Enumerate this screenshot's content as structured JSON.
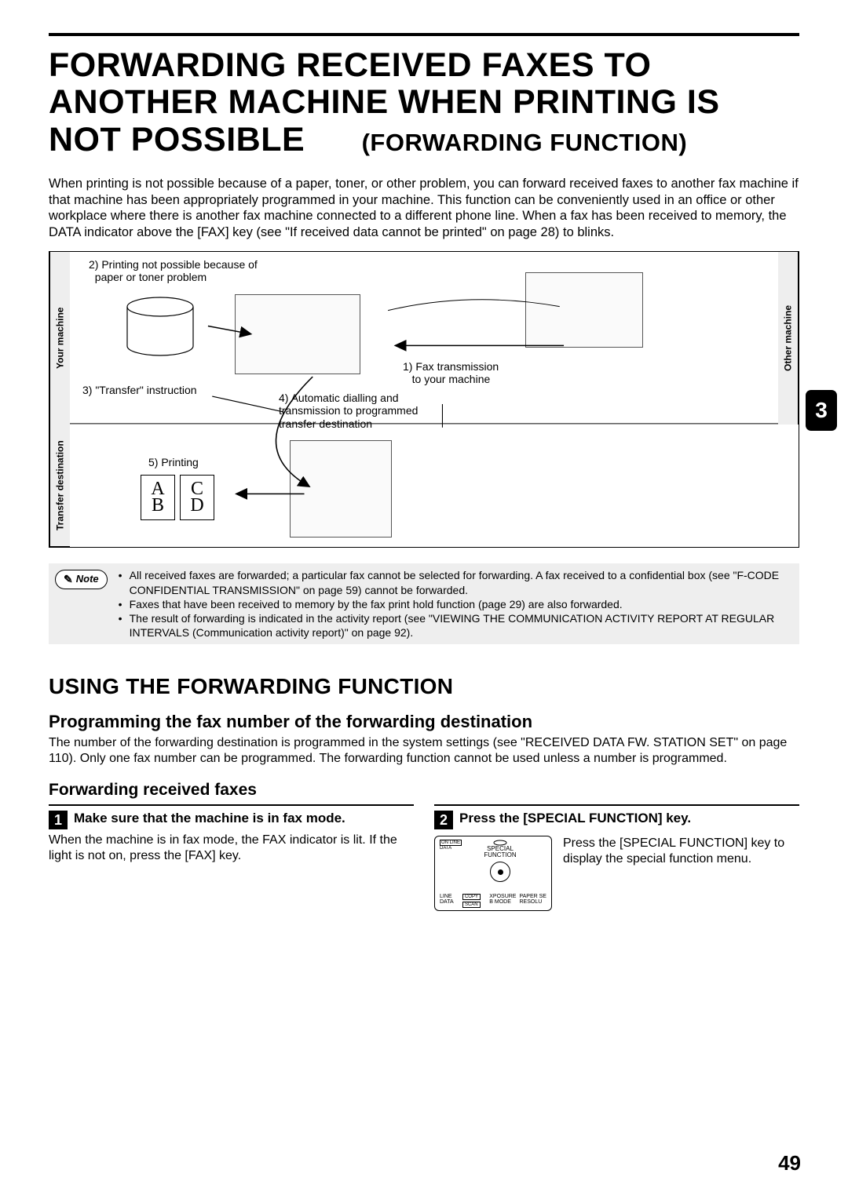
{
  "title_line1": "FORWARDING RECEIVED FAXES TO",
  "title_line2": "ANOTHER MACHINE WHEN PRINTING IS",
  "title_line3": "NOT POSSIBLE",
  "title_sub": "(FORWARDING FUNCTION)",
  "intro": "When printing is not possible because of a paper, toner, or other problem, you can forward received faxes to another fax machine if that machine has been appropriately programmed in your machine. This function can be conveniently used in an office or other workplace where there is another fax machine connected to a different phone line. When a fax has been received to memory, the DATA indicator above the [FAX] key (see \"If received data cannot be printed\" on page 28) to blinks.",
  "diagram": {
    "your_machine": "Your machine",
    "transfer_dest": "Transfer destination",
    "other_machine": "Other machine",
    "step1a": "1) Fax transmission",
    "step1b": "to your machine",
    "step2a": "2) Printing not possible because of",
    "step2b": "paper or toner problem",
    "step3": "3) \"Transfer\" instruction",
    "step4a": "4) Automatic dialling and",
    "step4b": "transmission to programmed",
    "step4c": "transfer destination",
    "step5": "5) Printing",
    "doc_labels": {
      "a": "A",
      "b": "B",
      "c": "C",
      "d": "D"
    }
  },
  "chapter_tab": "3",
  "note_label": "Note",
  "notes": [
    "All received faxes are forwarded; a particular fax cannot be selected for forwarding. A fax received to a confidential box (see \"F-CODE CONFIDENTIAL TRANSMISSION\" on page 59) cannot be forwarded.",
    "Faxes that have been received to memory by the fax print hold function (page 29) are also forwarded.",
    "The result of forwarding is indicated in the activity report (see \"VIEWING THE COMMUNICATION ACTIVITY REPORT AT REGULAR INTERVALS (Communication activity report)\" on page 92)."
  ],
  "h2": "USING THE FORWARDING FUNCTION",
  "h3": "Programming the fax number of the forwarding destination",
  "para": "The number of the forwarding destination is programmed in the system settings (see \"RECEIVED DATA FW. STATION SET\" on page 110). Only one fax number can be programmed. The forwarding function cannot be used unless a number is programmed.",
  "h3b": "Forwarding received faxes",
  "steps": {
    "s1_num": "1",
    "s1_title": "Make sure that the machine is in fax mode.",
    "s1_body": "When the machine is in fax mode, the FAX indicator is lit. If the light is not on, press the [FAX] key.",
    "s2_num": "2",
    "s2_title": "Press the [SPECIAL FUNCTION] key.",
    "s2_body": "Press the [SPECIAL FUNCTION] key to display the special function menu."
  },
  "keypanel": {
    "online": "ON LINE",
    "data": "DATA",
    "label1": "SPECIAL",
    "label2": "FUNCTION",
    "line": "LINE",
    "data2": "DATA",
    "b1": "COPY",
    "b2": "SCAN",
    "b3": "XPOSURE",
    "b4": "B MODE",
    "b5": "PAPER SE",
    "b6": "RESOLU"
  },
  "page_number": "49"
}
